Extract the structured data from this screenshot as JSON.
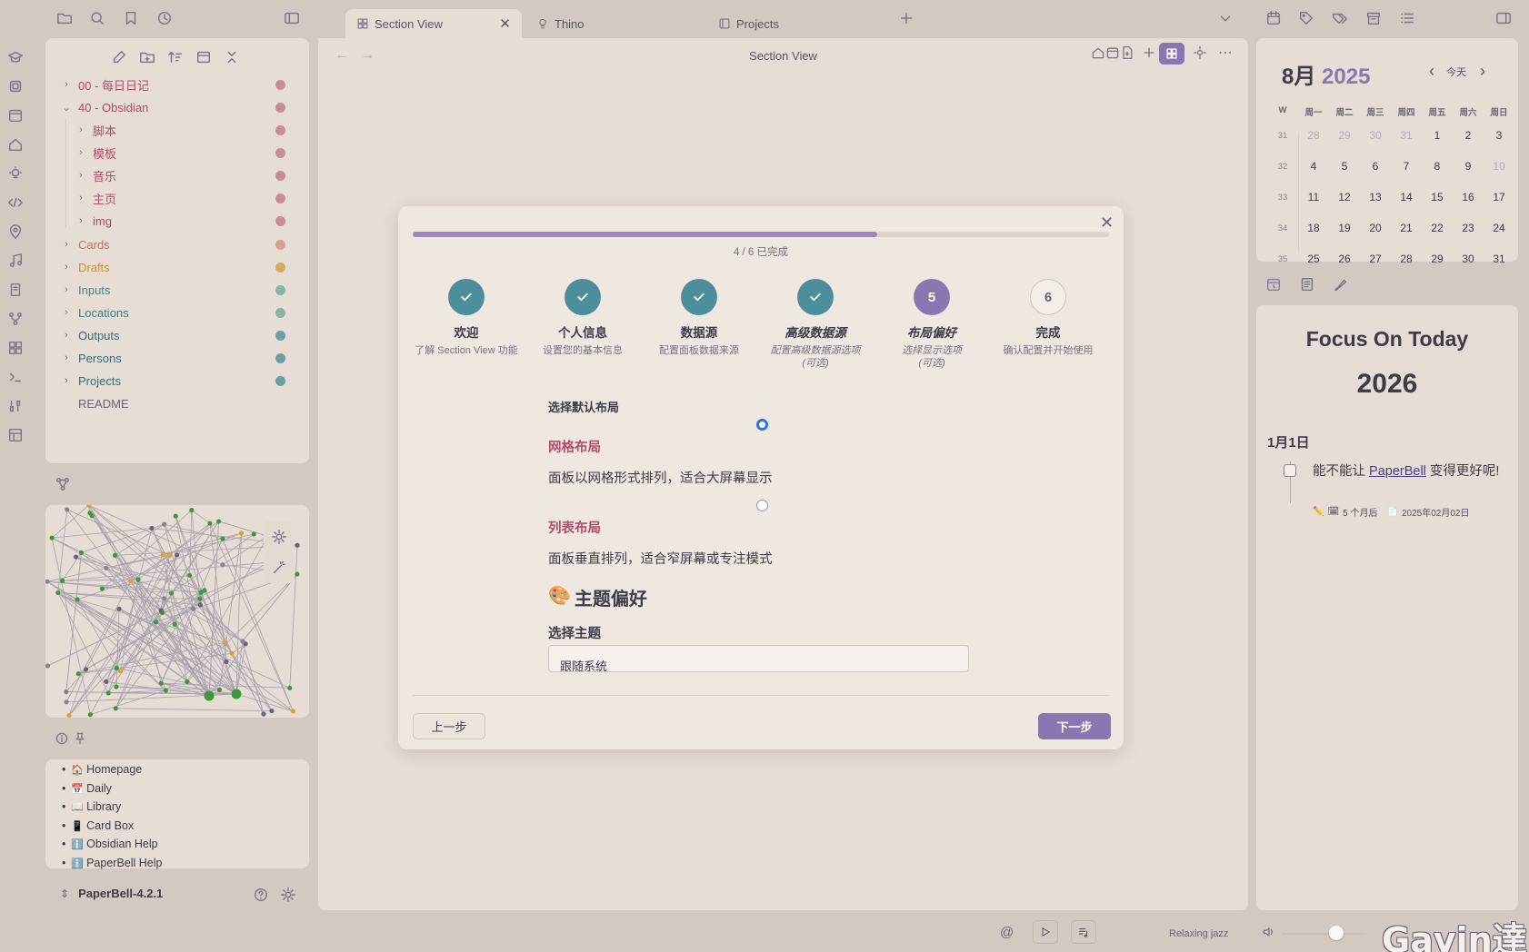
{
  "tabs": [
    {
      "label": "Section View",
      "close": "✕"
    },
    {
      "label": "Thino"
    },
    {
      "label": "Projects"
    }
  ],
  "file_tree": {
    "items": [
      {
        "label": "00 - 每日日记",
        "color": "#b34c6a",
        "dot": "#c98d97"
      },
      {
        "label": "40 - Obsidian",
        "color": "#b34c6a",
        "dot": "#c98d97"
      },
      {
        "label": "脚本",
        "color": "#b34c6a",
        "dot": "#c98d97"
      },
      {
        "label": "模板",
        "color": "#b34c6a",
        "dot": "#c98d97"
      },
      {
        "label": "音乐",
        "color": "#b34c6a",
        "dot": "#c98d97"
      },
      {
        "label": "主页",
        "color": "#b34c6a",
        "dot": "#c98d97"
      },
      {
        "label": "img",
        "color": "#b34c6a",
        "dot": "#c98d97"
      },
      {
        "label": "Cards",
        "color": "#c7735e",
        "dot": "#d4a291"
      },
      {
        "label": "Drafts",
        "color": "#d08c3c",
        "dot": "#d9a95b"
      },
      {
        "label": "Inputs",
        "color": "#3f8a8a",
        "dot": "#86b3ac"
      },
      {
        "label": "Locations",
        "color": "#3b7f86",
        "dot": "#86b3ac"
      },
      {
        "label": "Outputs",
        "color": "#2f6f7e",
        "dot": "#6f9fa4"
      },
      {
        "label": "Persons",
        "color": "#2f6f7e",
        "dot": "#6f9fa4"
      },
      {
        "label": "Projects",
        "color": "#2f6f7e",
        "dot": "#6f9fa4"
      },
      {
        "label": "README",
        "color": "#6b6474"
      }
    ]
  },
  "bookmarks": [
    {
      "emoji": "🏠",
      "label": "Homepage"
    },
    {
      "emoji": "📅",
      "label": "Daily"
    },
    {
      "emoji": "📖",
      "label": "Library"
    },
    {
      "emoji": "📱",
      "label": "Card Box"
    },
    {
      "emoji": "ℹ️",
      "label": "Obsidian Help"
    },
    {
      "emoji": "ℹ️",
      "label": "PaperBell Help"
    }
  ],
  "vault": {
    "name": "PaperBell-4.2.1"
  },
  "main": {
    "header_title": "Section View"
  },
  "modal": {
    "progress": 0.6667,
    "progress_text": "4 / 6 已完成",
    "steps": [
      {
        "title": "欢迎",
        "desc": "了解 Section View 功能",
        "state": "done"
      },
      {
        "title": "个人信息",
        "desc": "设置您的基本信息",
        "state": "done"
      },
      {
        "title": "数据源",
        "desc": "配置面板数据来源",
        "state": "done"
      },
      {
        "title": "高级数据源",
        "desc": "配置高级数据源选项",
        "desc2": "(可选)",
        "state": "done",
        "optional": true
      },
      {
        "title": "布局偏好",
        "num": "5",
        "desc": "选择显示选项",
        "desc2": "(可选)",
        "state": "current",
        "optional": true
      },
      {
        "title": "完成",
        "num": "6",
        "desc": "确认配置并开始使用",
        "state": "todo"
      }
    ],
    "section_label": "选择默认布局",
    "options": [
      {
        "title": "网格布局",
        "desc": "面板以网格形式排列，适合大屏幕显示",
        "checked": true
      },
      {
        "title": "列表布局",
        "desc": "面板垂直排列，适合窄屏幕或专注模式",
        "checked": false
      }
    ],
    "theme_heading": "主题偏好",
    "theme_emoji": "🎨",
    "theme_label": "选择主题",
    "theme_value": "跟随系统",
    "prev_label": "上一步",
    "next_label": "下一步"
  },
  "calendar": {
    "month": "8月",
    "year": "2025",
    "today_label": "今天",
    "weekday_headers": [
      "W",
      "周一",
      "周二",
      "周三",
      "周四",
      "周五",
      "周六",
      "周日"
    ],
    "weeks": [
      {
        "num": "31",
        "days": [
          "28",
          "29",
          "30",
          "31",
          "1",
          "2",
          "3"
        ],
        "dim": [
          true,
          true,
          true,
          true,
          false,
          false,
          false
        ]
      },
      {
        "num": "32",
        "days": [
          "4",
          "5",
          "6",
          "7",
          "8",
          "9",
          "10"
        ],
        "dim": [
          false,
          false,
          false,
          false,
          false,
          false,
          true
        ]
      },
      {
        "num": "33",
        "days": [
          "11",
          "12",
          "13",
          "14",
          "15",
          "16",
          "17"
        ],
        "dim": [
          false,
          false,
          false,
          false,
          false,
          false,
          false
        ]
      },
      {
        "num": "34",
        "days": [
          "18",
          "19",
          "20",
          "21",
          "22",
          "23",
          "24"
        ],
        "dim": [
          false,
          false,
          false,
          false,
          false,
          false,
          false
        ]
      },
      {
        "num": "35",
        "days": [
          "25",
          "26",
          "27",
          "28",
          "29",
          "30",
          "31"
        ],
        "dim": [
          false,
          false,
          false,
          false,
          false,
          false,
          false
        ]
      }
    ]
  },
  "focus": {
    "title": "Focus On Today",
    "year": "2026",
    "date": "1月1日",
    "task_text_prefix": "能不能让 ",
    "task_link": "PaperBell",
    "task_text_suffix": " 变得更好呢!",
    "meta1": "5 个月后",
    "meta2": "2025年02月02日"
  },
  "status": {
    "track": "Relaxing jazz",
    "watermark": "Gavin達"
  },
  "colors": {
    "accent": "#8a76b0",
    "done": "#4c8f9a",
    "progress": "#9b86be"
  }
}
